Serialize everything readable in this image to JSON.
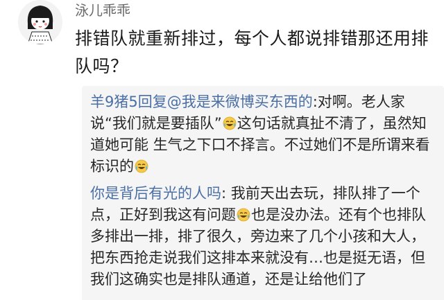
{
  "comment": {
    "username": "泳儿乖乖",
    "text": "排错队就重新排过，每个人都说排错那还用排队吗？"
  },
  "replies": [
    {
      "prefix": "羊9猪5回复",
      "mention": "@我是来微博买东西的",
      "text_1": ":对啊。老人家说“我们就是要插队”",
      "emoji_1": "crying-laughing-emoji",
      "text_2": "这句话就真扯不清了，虽然知道她可能 生气之下口不择言。不过她们不是所谓来看标识的",
      "emoji_2": "crying-laughing-emoji"
    },
    {
      "author": "你是背后有光的人吗",
      "text_1": ": 我前天出去玩，排队排了一个点，正好到我这有问题",
      "emoji_1": "crying-laughing-emoji",
      "text_2": "也是没办法。还有个也排队多排出一排，排了很久，旁边来了几个小孩和大人，把东西抢走说我们这排本来就没有…也是挺无语，但我们这确实也是排队通道，还是让给他们了"
    }
  ],
  "colors": {
    "name_link": "#4a6fa5",
    "text": "#262626",
    "reply_bg": "#f5f5f5"
  }
}
